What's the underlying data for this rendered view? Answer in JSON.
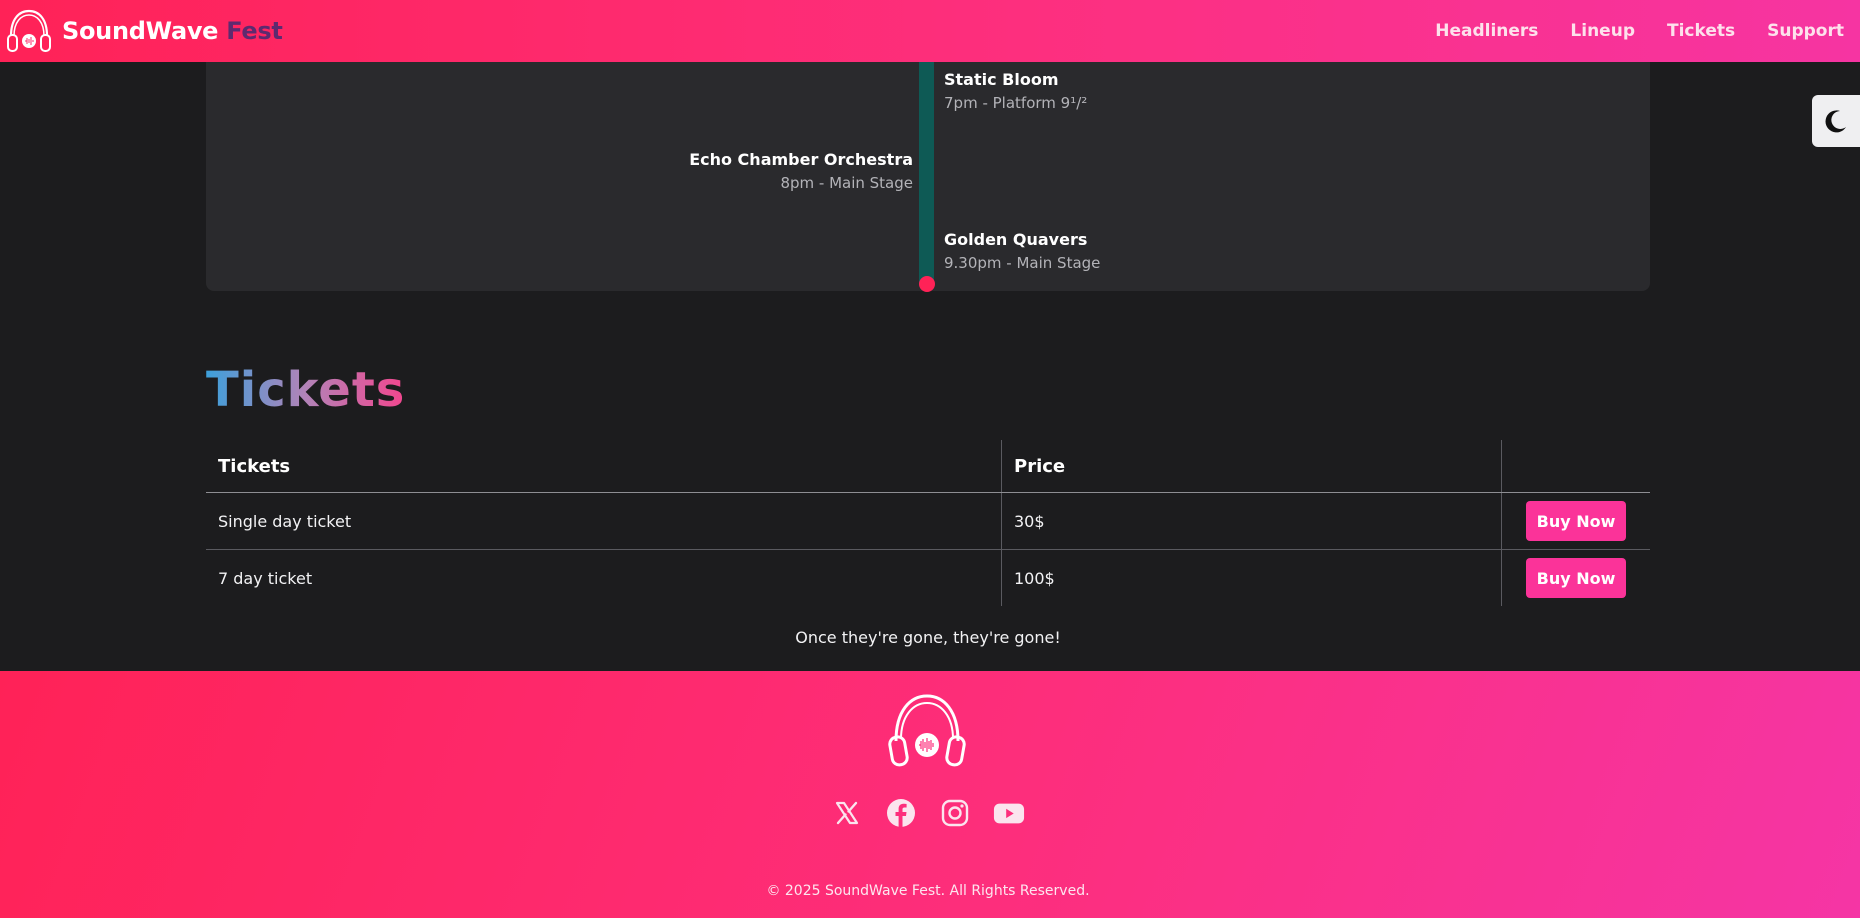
{
  "header": {
    "brand_primary": "SoundWave",
    "brand_secondary": "Fest",
    "nav": [
      "Headliners",
      "Lineup",
      "Tickets",
      "Support"
    ]
  },
  "timeline": {
    "events": [
      {
        "name": "Static Bloom",
        "meta": "7pm - Platform 9¹/²",
        "side": "right"
      },
      {
        "name": "Echo Chamber Orchestra",
        "meta": "8pm - Main Stage",
        "side": "left"
      },
      {
        "name": "Golden Quavers",
        "meta": "9.30pm - Main Stage",
        "side": "right"
      }
    ]
  },
  "tickets": {
    "title": "Tickets",
    "headers": [
      "Tickets",
      "Price",
      ""
    ],
    "rows": [
      {
        "name": "Single day ticket",
        "price": "30$",
        "action": "Buy Now"
      },
      {
        "name": "7 day ticket",
        "price": "100$",
        "action": "Buy Now"
      }
    ],
    "tagline": "Once they're gone, they're gone!"
  },
  "footer": {
    "socials": [
      "x-icon",
      "facebook-icon",
      "instagram-icon",
      "youtube-icon"
    ],
    "copyright": "© 2025 SoundWave Fest. All Rights Reserved."
  },
  "colors": {
    "accent_pink": "#fb3399",
    "header_gradient_start": "#ff2257",
    "timeline_bar": "#0e5a55"
  },
  "theme_toggle_icon": "moon-icon"
}
